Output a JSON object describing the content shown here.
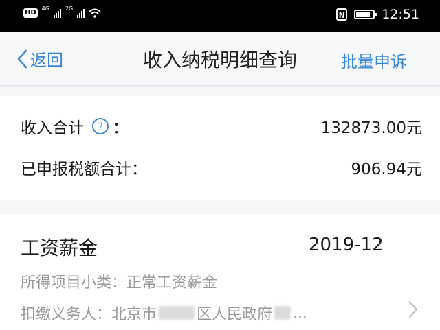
{
  "status_bar": {
    "hd_badge": "HD",
    "network_1": "4G",
    "network_2": "2G",
    "nfc_label": "N",
    "battery_level": 0.85,
    "time": "12:51"
  },
  "nav": {
    "back_label": "返回",
    "title": "收入纳税明细查询",
    "batch_label": "批量申诉"
  },
  "summary": {
    "income_label": "收入合计",
    "help_symbol": "?",
    "income_colon": "：",
    "income_value": "132873.00元",
    "tax_label": "已申报税额合计：",
    "tax_value": "906.94元"
  },
  "record": {
    "category": "工资薪金",
    "period": "2019-12",
    "subcategory_line": "所得项目小类：正常工资薪金",
    "payer_prefix": "扣缴义务人：北京市",
    "payer_middle": "区人民政府",
    "payer_suffix": "..."
  },
  "colors": {
    "accent": "#3a86d6",
    "secondary_text": "#9a9a9a",
    "background": "#f4f5f7"
  }
}
